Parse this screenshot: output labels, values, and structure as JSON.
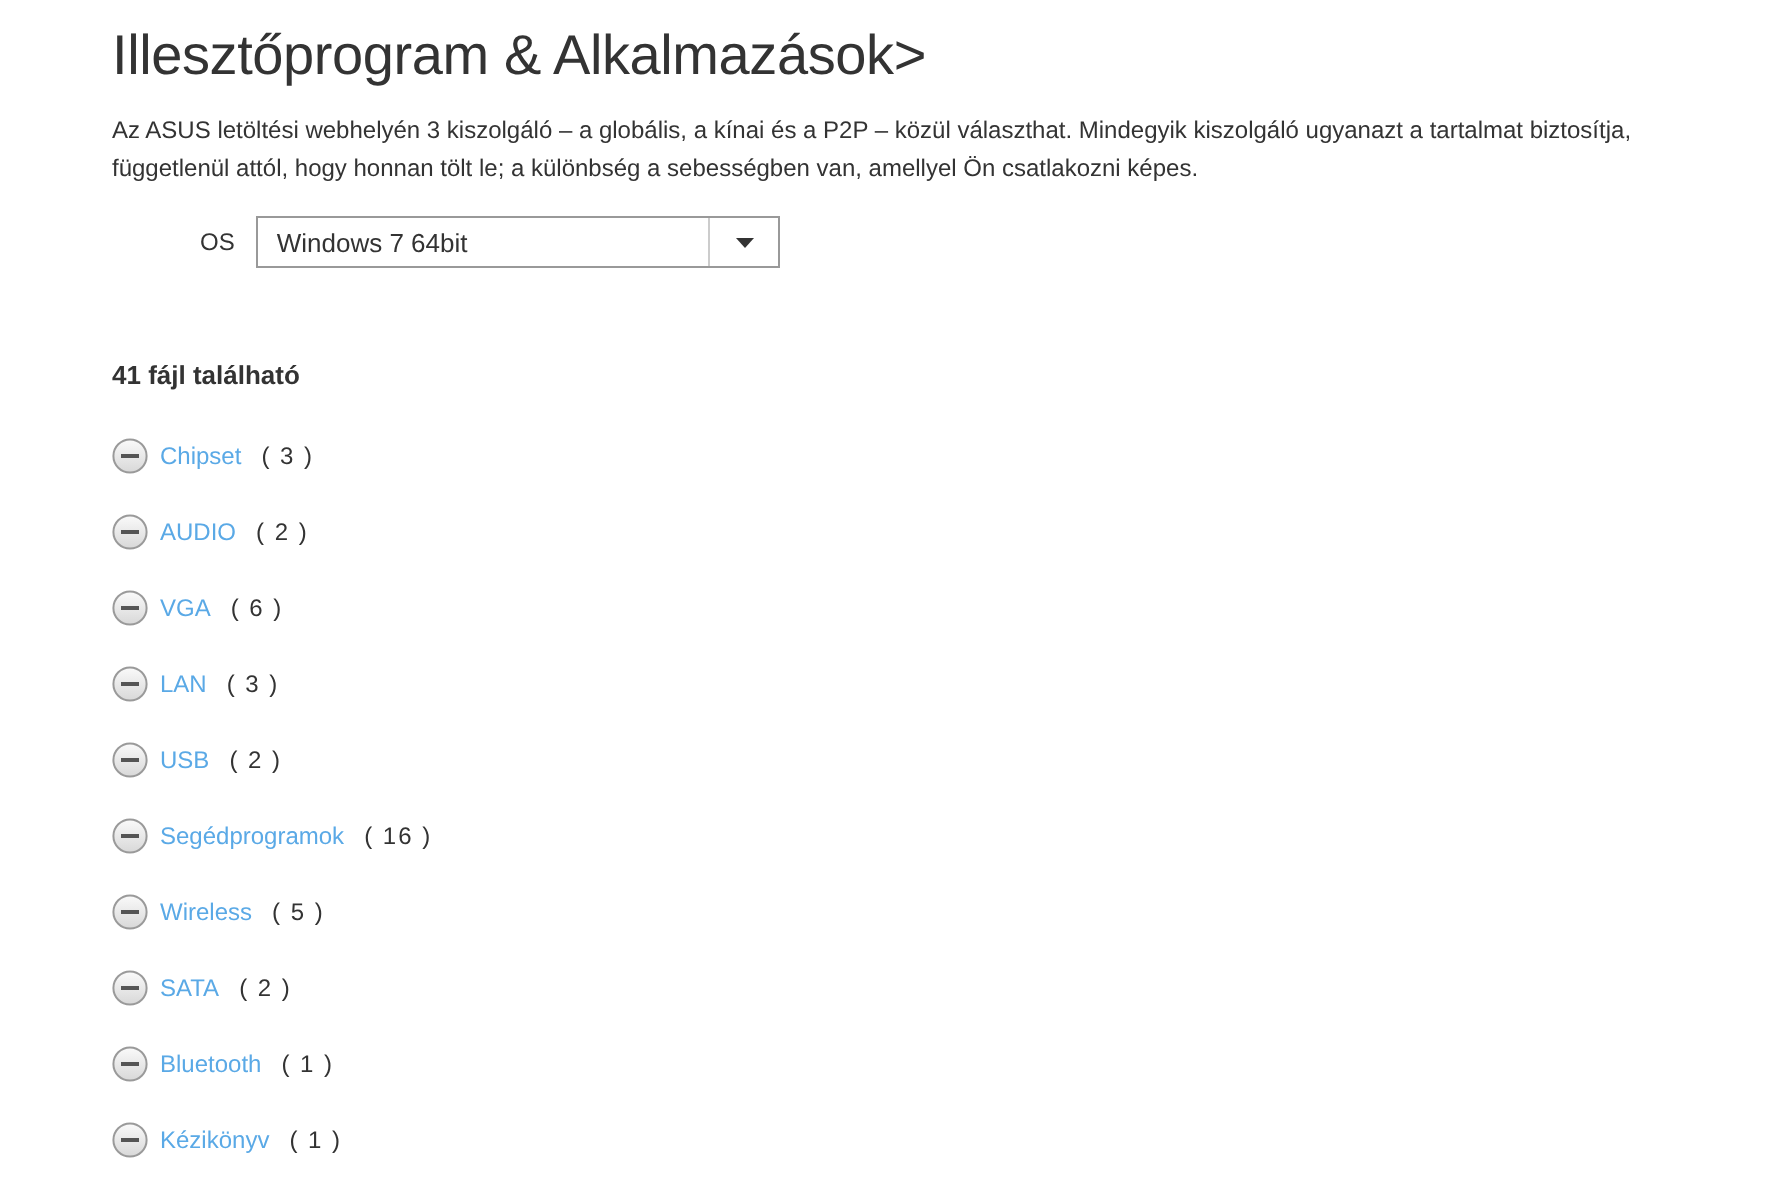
{
  "title": "Illesztőprogram & Alkalmazások>",
  "intro": "Az ASUS letöltési webhelyén 3 kiszolgáló – a globális, a kínai és a P2P – közül választhat. Mindegyik kiszolgáló ugyanazt a tartalmat biztosítja, függetlenül attól, hogy honnan tölt le; a különbség a sebességben van, amellyel Ön csatlakozni képes.",
  "os": {
    "label": "OS",
    "value": "Windows 7 64bit"
  },
  "found": "41 fájl található",
  "categories": [
    {
      "name": "Chipset",
      "count": "( 3 )"
    },
    {
      "name": "AUDIO",
      "count": "( 2 )"
    },
    {
      "name": "VGA",
      "count": "( 6 )"
    },
    {
      "name": "LAN",
      "count": "( 3 )"
    },
    {
      "name": "USB",
      "count": "( 2 )"
    },
    {
      "name": "Segédprogramok",
      "count": "( 16 )"
    },
    {
      "name": "Wireless",
      "count": "( 5 )"
    },
    {
      "name": "SATA",
      "count": "( 2 )"
    },
    {
      "name": "Bluetooth",
      "count": "( 1 )"
    },
    {
      "name": "Kézikönyv",
      "count": "( 1 )"
    }
  ]
}
